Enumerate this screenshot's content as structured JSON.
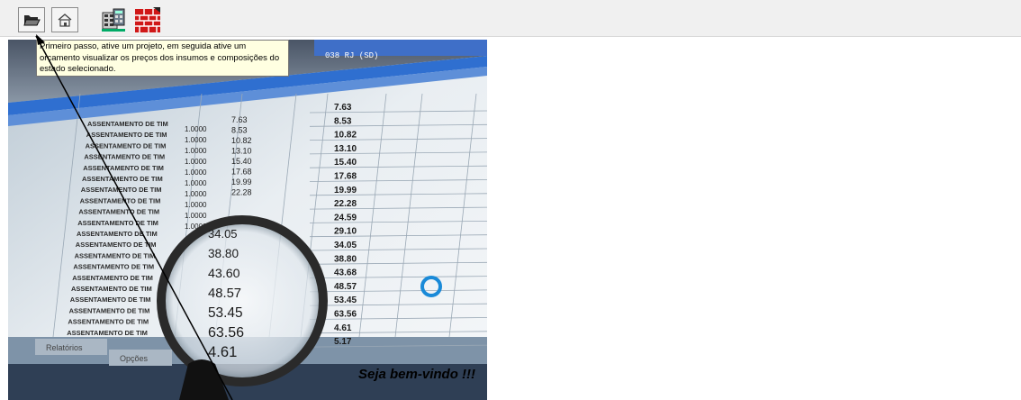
{
  "toolbar": {
    "buttons": [
      {
        "icon": "open-folder-icon",
        "active": true
      },
      {
        "icon": "home-icon"
      },
      {
        "icon": "calculator-building-icon"
      },
      {
        "icon": "brick-wall-icon"
      }
    ]
  },
  "tooltip": {
    "text": "Primeiro passo, ative um projeto, em seguida ative um orçamento visualizar os preços dos insumos e composições do estado selecionado."
  },
  "background": {
    "left_values": [
      "1.0000",
      "1.0000",
      "1.0000",
      "1.0000",
      "1.0000",
      "1.0000",
      "1.0000",
      "1.0000",
      "1.0000",
      "1.0000"
    ],
    "mid_values": [
      "7.63",
      "8.53",
      "10.82",
      "13.10",
      "15.40",
      "17.68",
      "19.99",
      "22.28"
    ],
    "magnified_values": [
      "34.05",
      "38.80",
      "43.60",
      "48.57",
      "53.45",
      "63.56",
      "4.61"
    ],
    "right_values": [
      "7.63",
      "8.53",
      "10.82",
      "13.10",
      "15.40",
      "17.68",
      "19.99",
      "22.28",
      "24.59",
      "29.10",
      "34.05",
      "38.80",
      "43.68",
      "48.57",
      "53.45",
      "63.56",
      "4.61",
      "5.17"
    ],
    "row_label": "ASSENTAMENTO DE TIM",
    "header_text": "038 RJ (SD)",
    "bottom_buttons": [
      "Relatórios",
      "Opções"
    ]
  },
  "welcome": "Seja bem-vindo !!!",
  "colors": {
    "tooltip_bg": "#ffffe1",
    "accent_blue": "#1a8ad8",
    "toolbar_bg": "#f0f0f0"
  }
}
